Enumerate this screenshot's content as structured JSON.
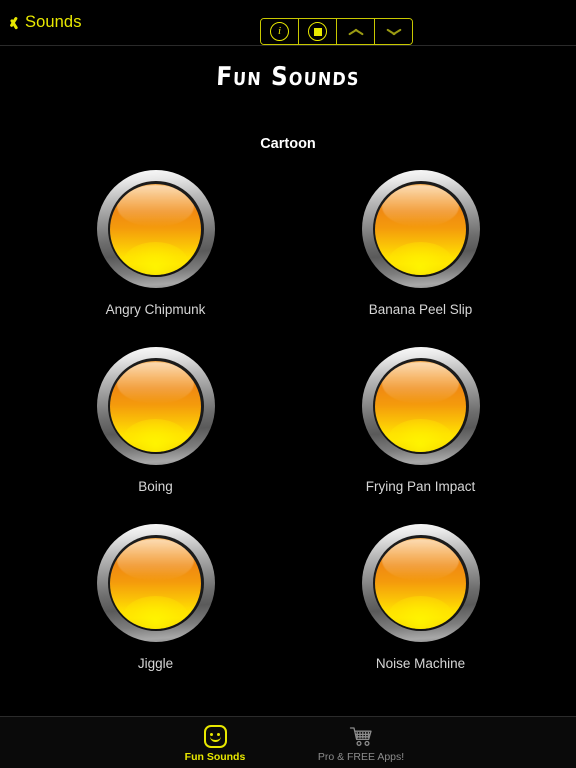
{
  "nav": {
    "back_label": "Sounds",
    "back_icon": "chevron-left-icon",
    "segments": [
      {
        "id": "info",
        "icon": "info-circle-icon",
        "glyph": "i"
      },
      {
        "id": "stop",
        "icon": "stop-circle-icon",
        "glyph": ""
      },
      {
        "id": "prev",
        "icon": "chevron-up-icon",
        "glyph": ""
      },
      {
        "id": "next",
        "icon": "chevron-down-icon",
        "glyph": ""
      }
    ]
  },
  "header": {
    "title": "Fun Sounds"
  },
  "main": {
    "section_title": "Cartoon",
    "sounds": [
      {
        "label": "Angry Chipmunk"
      },
      {
        "label": "Banana Peel Slip"
      },
      {
        "label": "Boing"
      },
      {
        "label": "Frying Pan Impact"
      },
      {
        "label": "Jiggle"
      },
      {
        "label": "Noise Machine"
      }
    ]
  },
  "tabbar": {
    "items": [
      {
        "label": "Fun Sounds",
        "icon": "smiley-face-icon",
        "active": true
      },
      {
        "label": "Pro & FREE Apps!",
        "icon": "shopping-cart-icon",
        "active": false
      }
    ]
  },
  "colors": {
    "accent": "#e8e800",
    "background": "#000000",
    "label": "#d6d6d6",
    "inactive_tab": "#8c8c8c"
  }
}
